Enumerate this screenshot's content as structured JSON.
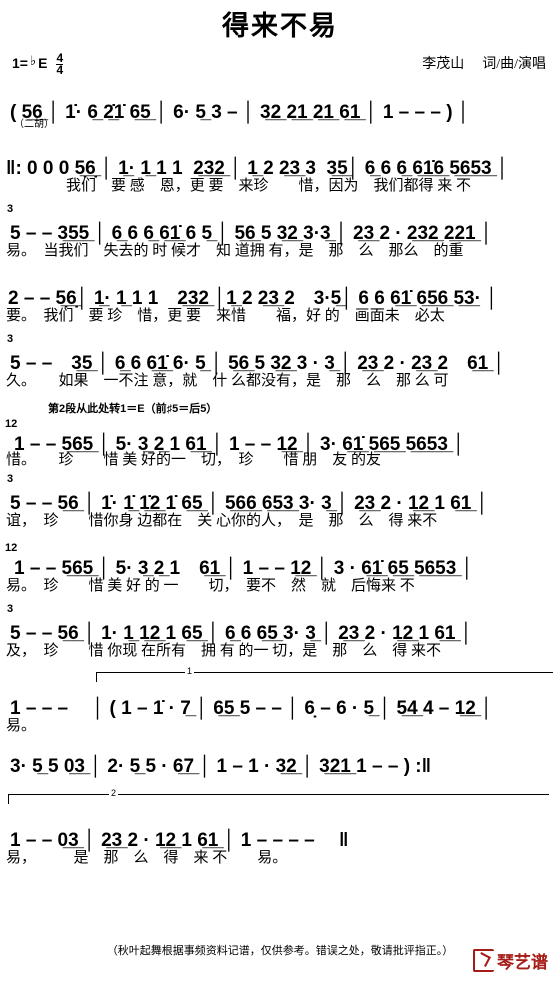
{
  "header": {
    "title": "得来不易",
    "key_prefix": "1=",
    "key_accidental": "♭",
    "key_letter": "E",
    "time_num": "4",
    "time_den": "4",
    "author": "李茂山",
    "credit": "词/曲/演唱"
  },
  "annotations": {
    "erhu": "（二胡）",
    "modulation": "第2段从此处转1＝E（前♯5＝后5）",
    "ending_1": "1",
    "ending_2": "2"
  },
  "rows": [
    {
      "id": "intro",
      "notes": "( 5̲6̲ │ 1̇· 6̲ 2̲̇1̇ 6̲5̲ │ 6· 5̲ 3 – │ 3̲2̲ 2̲1̲ 2̲1̲ 6̲1̲ │ 1 – – – ) │",
      "lyrics": ""
    },
    {
      "id": "line-1",
      "notes": "‖: 0 0 0 5̲̣6̲̣ │ 1̲· 1̲ 1 1  2̲3̲2̲ │ 1̲ 2 2̲3̲ 3  3̲5̲│ 6̲ 6 6̲ 6̲1̲̇6̲ 5̲6̲5̲3̲ │",
      "lyrics": "　　　　我们　要 感　恩，更 要　来珍　　惜，因为　我们都得 来 不"
    },
    {
      "id": "line-2",
      "notes": "5 – – 3̲5̲5̲ │ 6̲ 6 6̲ 6̲1̲̇ 6 5̲ │ 5̲6̲ 5 3̲2̲ 3·3̲ │ 2̲3̲ 2 · 2̲3̲2̲ 2̲2̲1̲ │",
      "lyrics": "易。　当我们　失去的 时 候才　知 道拥 有，是　那　么　那么　的重"
    },
    {
      "id": "line-3",
      "notes": "2 – – 5̲̣6̲̣│ 1̲· 1̲ 1 1　2̲3̲2̲ │1̲ 2 2̲3̲ 2　3·5̲│ 6 6 6̲1̲̇ 6̲5̲6̲ 5̲3̲· │",
      "lyrics": "要。　我们　要 珍　惜，更 要　来惜　　福，好 的　画面未　必太"
    },
    {
      "id": "line-4",
      "notes": "5 – –　3̲5̲ │ 6̲ 6 6̲1̲̇ 6· 5̲ │ 5̲6̲ 5 3̲2̲ 3 · 3̲ │ 2̲3̲ 2 · 2̲3̲ 2　6̲1̲ │",
      "lyrics": "久。　　如果　一不注 意，就　什 么都没有，是　那　么　那 么 可"
    },
    {
      "id": "line-5",
      "notes": "1 – – 5̲6̲5̲ │ 5· 3̲ 2̲ 1 6̲1̲ │ 1 – – 1̲2̲ │ 3· 6̲1̲̇ 5̲6̲5̲ 5̲6̲5̲3̲ │",
      "lyrics": "惜。　　珍　　惜 美 好的一　切，　珍　　惜 朋　友 的友"
    },
    {
      "id": "line-6",
      "notes": "5 – – 5̲6̲ │ 1̇· 1̲̇ 1̲̇2̲ 1̇ 6̲5̲ │ 5̲6̲6̲ 6̲5̲3̲ 3· 3̲ │ 2̲3̲ 2 · 1̲2̲ 1 6̲1̲ │",
      "lyrics": "谊，　珍　　惜你身 边都在　关 心你的人，　是　那　么　得 来不"
    },
    {
      "id": "line-7",
      "notes": "1 – – 5̲6̲5̲ │ 5· 3̲ 2̲ 1　6̲1̲ │ 1 – – 1̲2̲ │ 3 · 6̲1̲̇ 6̲5̲ 5̲6̲5̲3̲ │",
      "lyrics": "易。　珍　　惜 美 好 的 一　　切，　要不　然　就　后悔来 不"
    },
    {
      "id": "line-8",
      "notes": "5 – – 5̲6̲ │ 1· 1̲ 1̲2̲ 1 6̲5̲ │ 6̲ 6 6̲5̲ 3· 3̲ │ 2̲3̲ 2 · 1̲2̲ 1 6̲1̲ │",
      "lyrics": "及，　珍　　惜 你现 在所有　拥 有 的一 切，是　那　么　得 来不"
    },
    {
      "id": "line-9",
      "notes": "1 – – – 　│ ( 1 – 1̇ · 7̲ │ 6̲5̲ 5 – – │ 6̣ – 6 · 5̲ │ 5̲4̲ 4 – 1̲2̲ │",
      "lyrics": "易。"
    },
    {
      "id": "line-10",
      "notes": "3· 5̲ 5 0̲3̲ │ 2· 5̲ 5 · 6̲7̲ │ 1 – 1 · 3̲2̲ │ 3̲2̲1̲ 1 – – ) :‖",
      "lyrics": ""
    },
    {
      "id": "line-11",
      "notes": "1 – – 0̲3̲ │ 2̲3̲ 2 · 1̲2̲ 1 6̲1̲ │ 1 – – – – 　‖",
      "lyrics": "易，　　　是　那　么　得　来 不　　易。"
    }
  ],
  "footer": {
    "note": "（秋叶起舞根据事频资料记谱，仅供参考。错误之处，敬请批评指正。）"
  },
  "logo": {
    "text": "琴艺谱",
    "color": "#a51b16"
  }
}
